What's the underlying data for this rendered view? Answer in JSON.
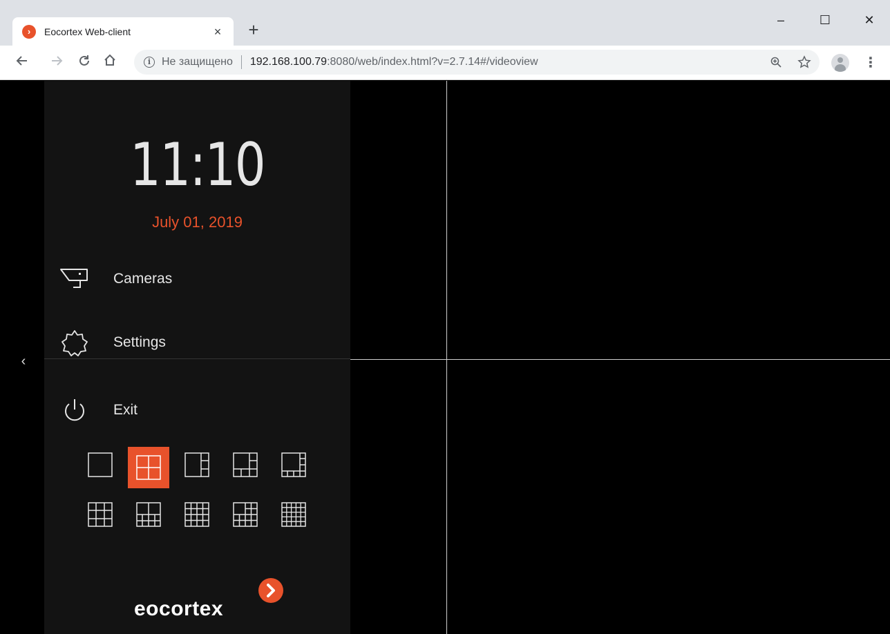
{
  "browser": {
    "tab_title": "Eocortex Web-client",
    "tab_close": "×",
    "new_tab": "+",
    "not_secure": "Не защищено",
    "url_host": "192.168.100.79",
    "url_rest": ":8080/web/index.html?v=2.7.14#/videoview",
    "info_glyph": "i",
    "window_controls": {
      "minimize": "–",
      "maximize": "☐",
      "close": "✕"
    }
  },
  "sidebar": {
    "time": "11:10",
    "date": "July 01, 2019",
    "items": [
      {
        "label": "Cameras",
        "icon": "camera-icon"
      },
      {
        "label": "Settings",
        "icon": "gear-icon"
      },
      {
        "label": "Exit",
        "icon": "power-icon"
      }
    ],
    "layouts": [
      {
        "name": "1x1",
        "active": false
      },
      {
        "name": "2x2",
        "active": true
      },
      {
        "name": "1+3",
        "active": false
      },
      {
        "name": "1+5",
        "active": false
      },
      {
        "name": "1+7",
        "active": false
      },
      {
        "name": "3x3",
        "active": false
      },
      {
        "name": "2+8",
        "active": false
      },
      {
        "name": "4x4",
        "active": false
      },
      {
        "name": "1+12",
        "active": false
      },
      {
        "name": "5x5",
        "active": false
      }
    ],
    "collapse_glyph": "‹",
    "brand": "eocortex"
  },
  "colors": {
    "accent": "#e8522b",
    "panel": "#131313",
    "video_bg": "#000000"
  }
}
